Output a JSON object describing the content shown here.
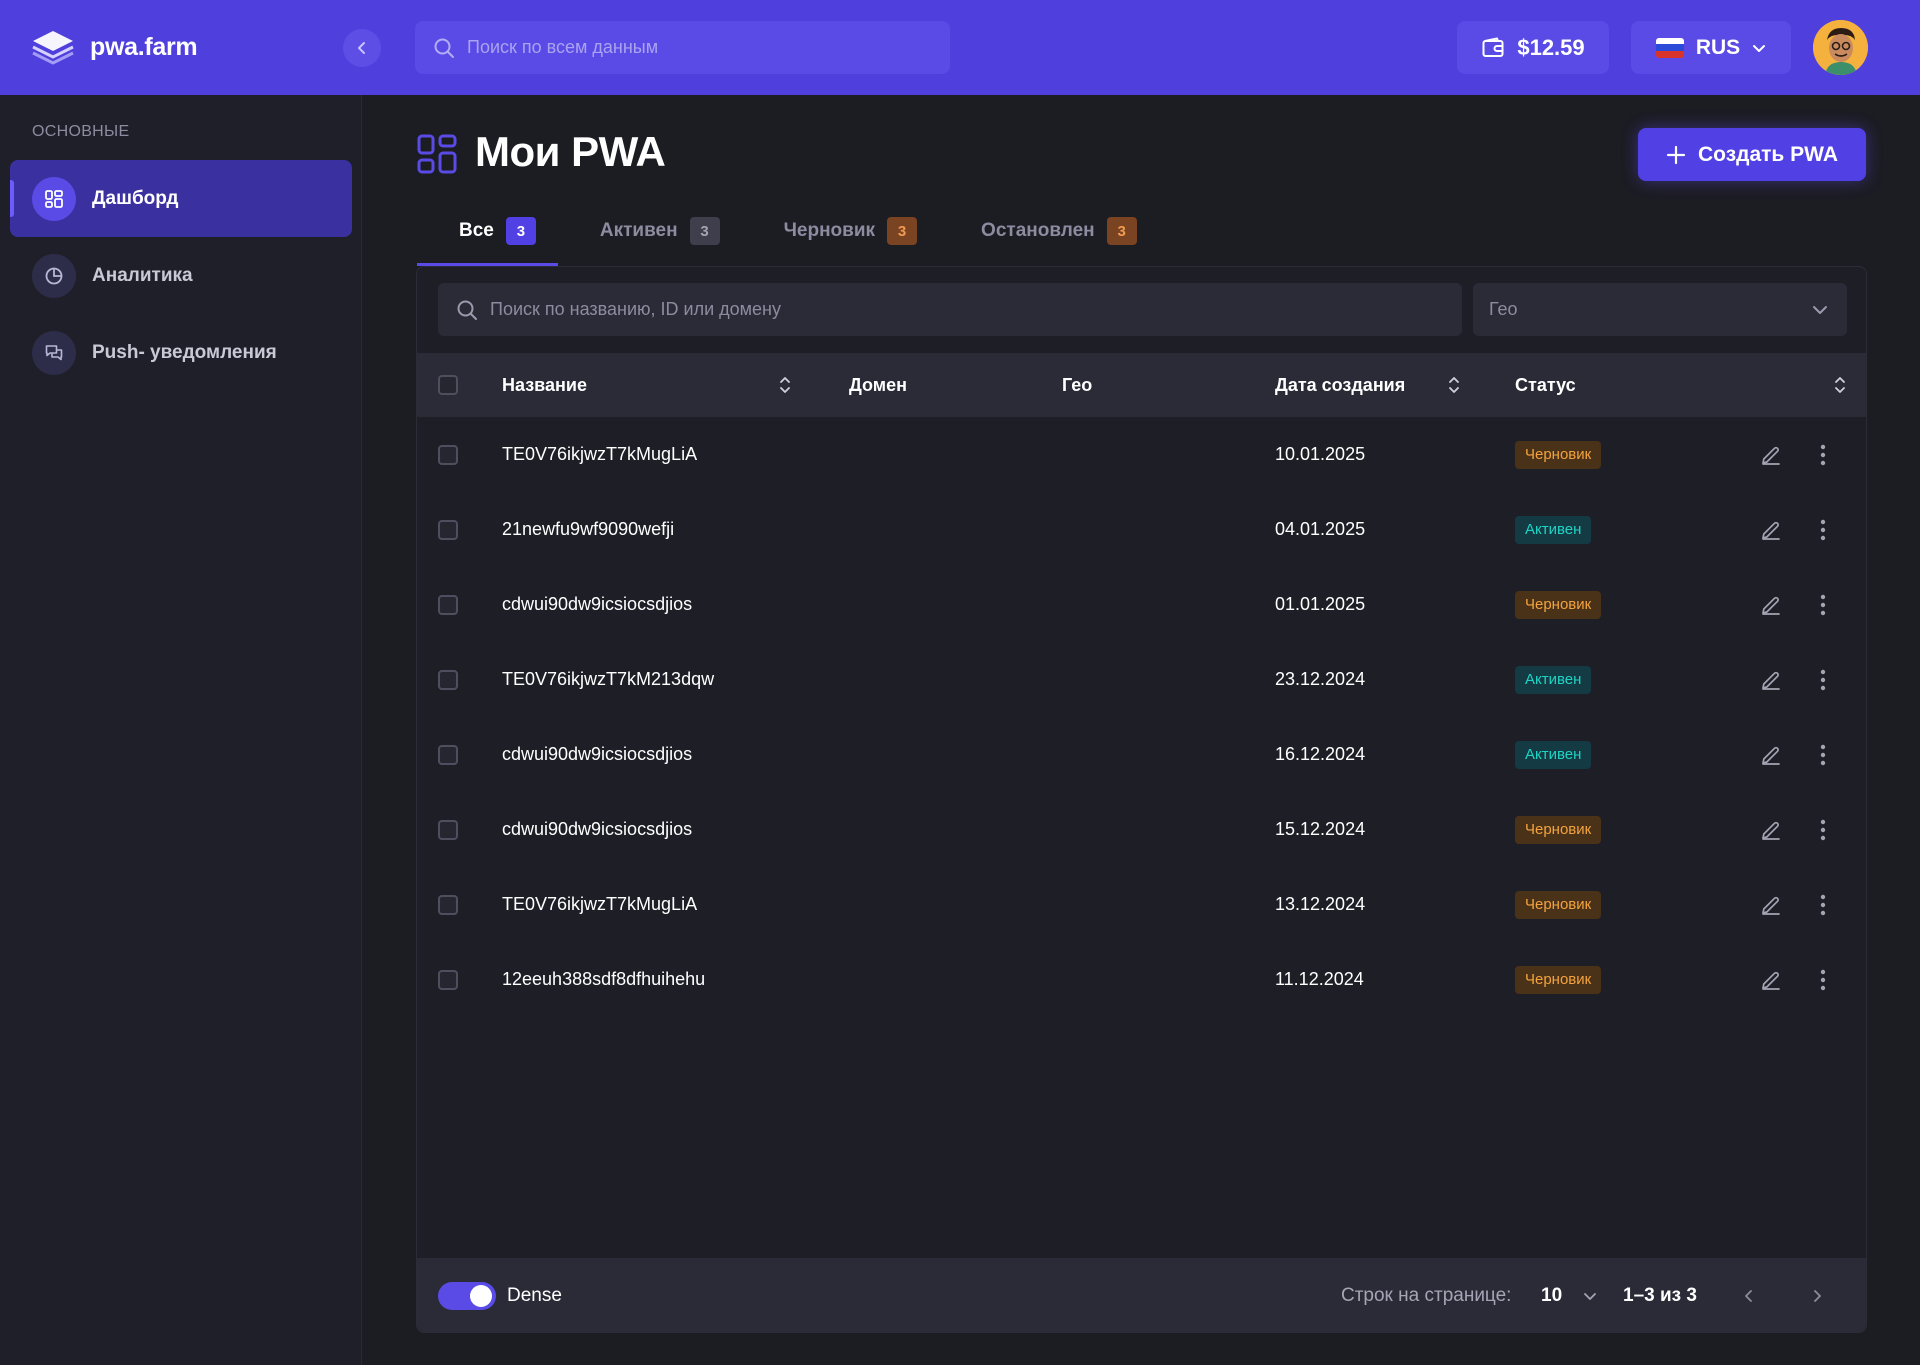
{
  "header": {
    "logo_text": "pwa.farm",
    "search_placeholder": "Поиск по всем данным",
    "balance": "$12.59",
    "language": "RUS"
  },
  "sidebar": {
    "section_label": "ОСНОВНЫЕ",
    "items": [
      {
        "label": "Дашборд",
        "icon": "dashboard-icon",
        "active": true
      },
      {
        "label": "Аналитика",
        "icon": "pie-chart-icon",
        "active": false
      },
      {
        "label": "Push- уведомления",
        "icon": "chat-icon",
        "active": false
      }
    ]
  },
  "main": {
    "title": "Мои PWA",
    "create_button": "Создать PWA",
    "tabs": [
      {
        "label": "Все",
        "count": "3",
        "active": true
      },
      {
        "label": "Активен",
        "count": "3",
        "active": false
      },
      {
        "label": "Черновик",
        "count": "3",
        "active": false
      },
      {
        "label": "Остановлен",
        "count": "3",
        "active": false
      }
    ],
    "filter_placeholder": "Поиск по названию, ID или домену",
    "geo_placeholder": "Гео"
  },
  "table": {
    "columns": {
      "name": "Название",
      "domain": "Домен",
      "geo": "Гео",
      "created": "Дата создания",
      "status": "Статус"
    },
    "rows": [
      {
        "name": "TE0V76ikjwzT7kMugLiA",
        "domain": "",
        "geo": "",
        "created": "10.01.2025",
        "status": "Черновик",
        "status_type": "draft"
      },
      {
        "name": "21newfu9wf9090wefji",
        "domain": "",
        "geo": "",
        "created": "04.01.2025",
        "status": "Активен",
        "status_type": "active"
      },
      {
        "name": "cdwui90dw9icsiocsdjios",
        "domain": "",
        "geo": "",
        "created": "01.01.2025",
        "status": "Черновик",
        "status_type": "draft"
      },
      {
        "name": "TE0V76ikjwzT7kM213dqw",
        "domain": "",
        "geo": "",
        "created": "23.12.2024",
        "status": "Активен",
        "status_type": "active"
      },
      {
        "name": "cdwui90dw9icsiocsdjios",
        "domain": "",
        "geo": "",
        "created": "16.12.2024",
        "status": "Активен",
        "status_type": "active"
      },
      {
        "name": "cdwui90dw9icsiocsdjios",
        "domain": "",
        "geo": "",
        "created": "15.12.2024",
        "status": "Черновик",
        "status_type": "draft"
      },
      {
        "name": "TE0V76ikjwzT7kMugLiA",
        "domain": "",
        "geo": "",
        "created": "13.12.2024",
        "status": "Черновик",
        "status_type": "draft"
      },
      {
        "name": "12eeuh388sdf8dfhuihehu",
        "domain": "",
        "geo": "",
        "created": "11.12.2024",
        "status": "Черновик",
        "status_type": "draft"
      }
    ]
  },
  "footer": {
    "dense_label": "Dense",
    "dense_on": true,
    "rows_per_page_label": "Строк на странице:",
    "rows_per_page": "10",
    "range": "1–3 из 3"
  },
  "colors": {
    "brand": "#4f3fdd",
    "draft": "#f3a23d",
    "active": "#1ed4c5"
  }
}
